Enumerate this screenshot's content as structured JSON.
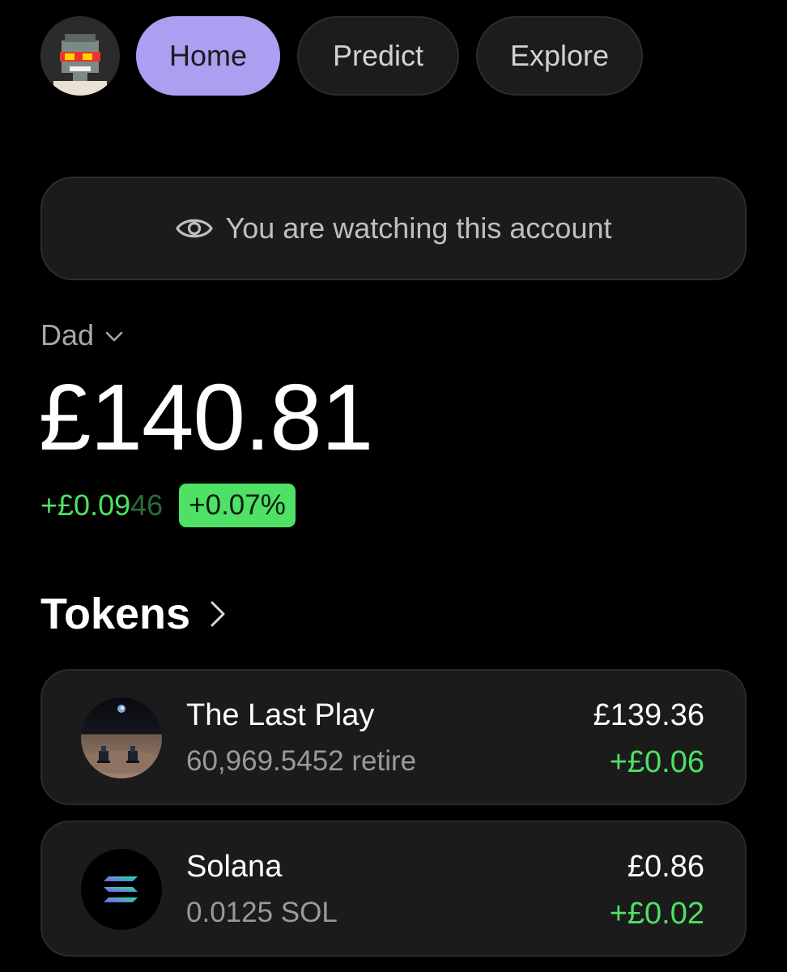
{
  "nav": {
    "tabs": [
      {
        "label": "Home",
        "active": true
      },
      {
        "label": "Predict",
        "active": false
      },
      {
        "label": "Explore",
        "active": false
      }
    ],
    "avatar_icon": "pixel-avatar-icon"
  },
  "watch_banner": {
    "icon": "eye-icon",
    "text": "You are watching this account"
  },
  "account": {
    "name": "Dad",
    "dropdown_icon": "chevron-down-icon"
  },
  "balance": {
    "total": "£140.81",
    "change_main": "+£0.09",
    "change_dim": "46",
    "change_percent": "+0.07%"
  },
  "tokens": {
    "title": "Tokens",
    "items": [
      {
        "name": "The Last Play",
        "amount": "60,969.5452 retire",
        "value": "£139.36",
        "change": "+£0.06",
        "icon": "the-last-play-token-icon"
      },
      {
        "name": "Solana",
        "amount": "0.0125 SOL",
        "value": "£0.86",
        "change": "+£0.02",
        "icon": "solana-token-icon"
      }
    ]
  },
  "colors": {
    "background": "#000000",
    "accent": "#ab9ff2",
    "positive": "#4ee165",
    "card": "#1b1b1b"
  }
}
